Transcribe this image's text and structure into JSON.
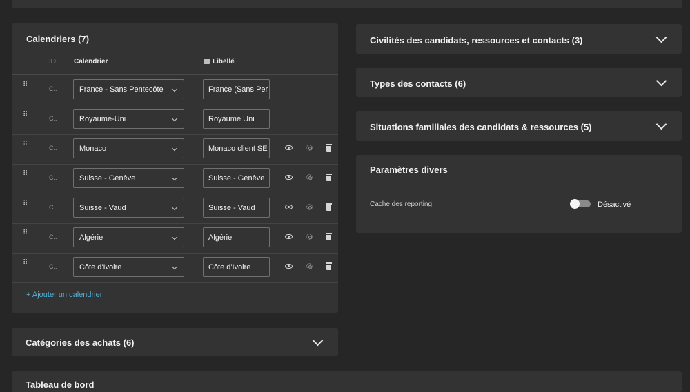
{
  "calendriers": {
    "title": "Calendriers (7)",
    "columns": {
      "id": "ID",
      "calendrier": "Calendrier",
      "libelle": "Libellé"
    },
    "rows": [
      {
        "id": "C..",
        "calendrier": "France - Sans Pentecôte",
        "libelle": "France (Sans Per",
        "actions": false
      },
      {
        "id": "C..",
        "calendrier": "Royaume-Uni",
        "libelle": "Royaume Uni",
        "actions": false
      },
      {
        "id": "C..",
        "calendrier": "Monaco",
        "libelle": "Monaco client SE",
        "actions": true
      },
      {
        "id": "C..",
        "calendrier": "Suisse - Genève",
        "libelle": "Suisse - Genève",
        "actions": true
      },
      {
        "id": "C..",
        "calendrier": "Suisse - Vaud",
        "libelle": "Suisse - Vaud",
        "actions": true
      },
      {
        "id": "C..",
        "calendrier": "Algérie",
        "libelle": "Algérie",
        "actions": true
      },
      {
        "id": "C..",
        "calendrier": "Côte d'Ivoire",
        "libelle": "Côte d'Ivoire",
        "actions": true
      }
    ],
    "add_label": "+ Ajouter un calendrier"
  },
  "categories_achats": {
    "title": "Catégories des achats (6)"
  },
  "civilites": {
    "title": "Civilités des candidats, ressources et contacts (3)"
  },
  "types_contacts": {
    "title": "Types des contacts (6)"
  },
  "situations": {
    "title": "Situations familiales des candidats & ressources (5)"
  },
  "parametres": {
    "title": "Paramètres divers",
    "cache_label": "Cache des reporting",
    "toggle_state": "Désactivé"
  },
  "bottom_panel": {
    "title": "Tableau de bord"
  }
}
